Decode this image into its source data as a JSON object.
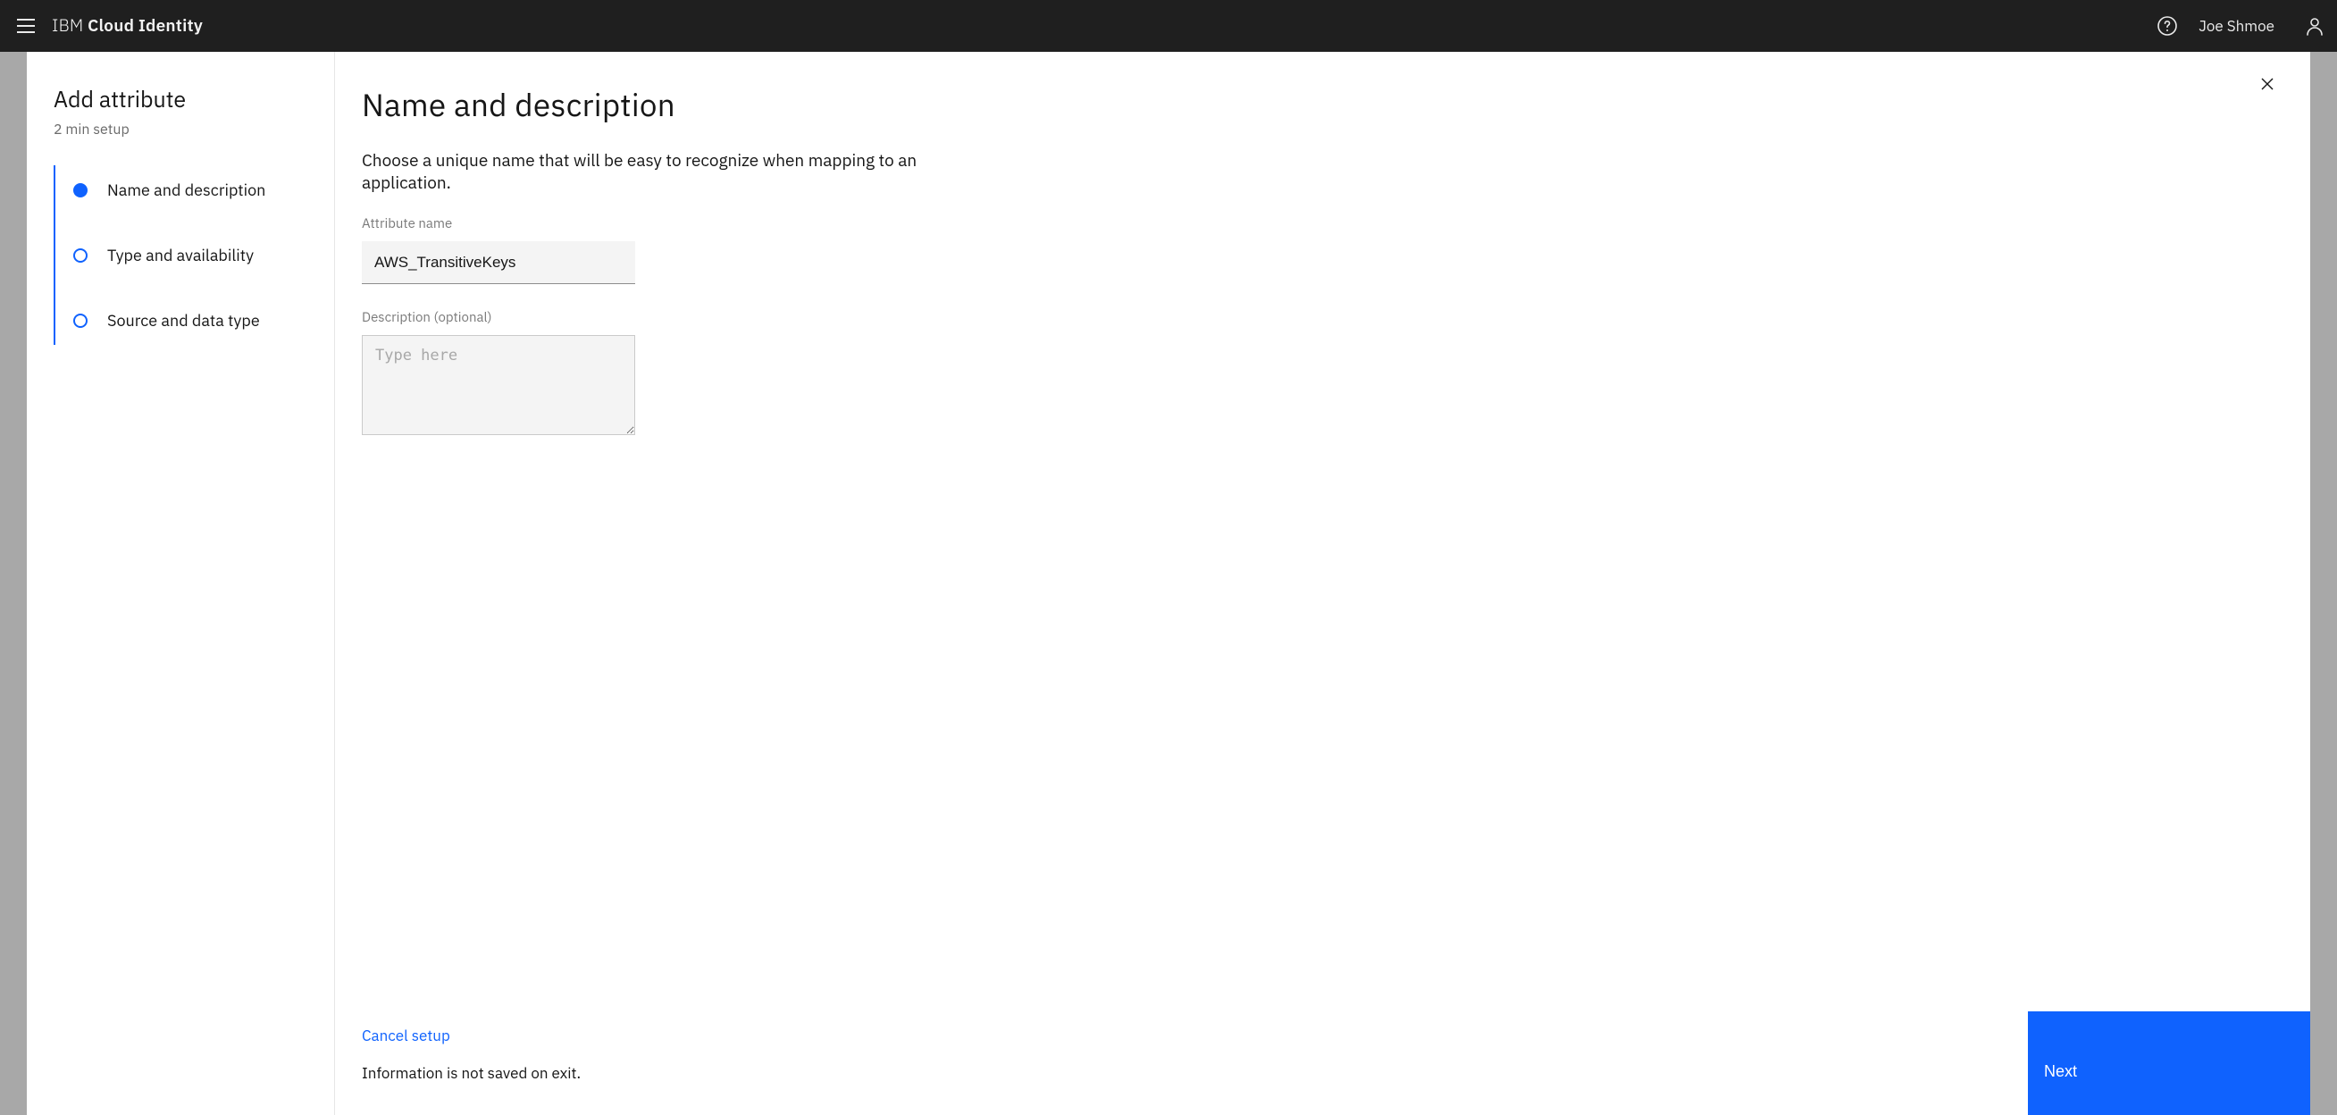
{
  "topbar": {
    "brand_light": "IBM ",
    "brand_bold": "Cloud Identity",
    "username": "Joe Shmoe"
  },
  "sidebar": {
    "title": "Add attribute",
    "subtitle": "2 min setup",
    "steps": [
      {
        "label": "Name and description",
        "state": "current"
      },
      {
        "label": "Type and availability",
        "state": "upcoming"
      },
      {
        "label": "Source and data type",
        "state": "upcoming"
      }
    ]
  },
  "main": {
    "title": "Name and description",
    "intro": "Choose a unique name that will be easy to recognize when mapping to an application.",
    "attribute_name_label": "Attribute name",
    "attribute_name_value": "AWS_TransitiveKeys",
    "description_label": "Description (optional)",
    "description_placeholder": "Type here",
    "description_value": "",
    "cancel_label": "Cancel setup",
    "cancel_note": "Information is not saved on exit.",
    "next_label": "Next"
  }
}
